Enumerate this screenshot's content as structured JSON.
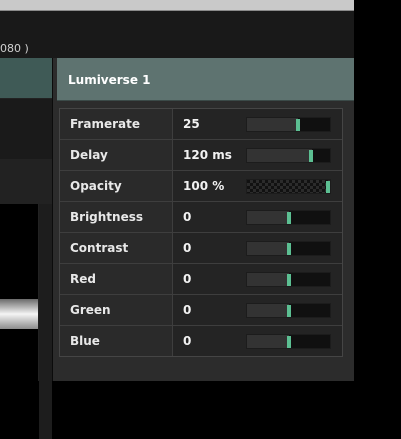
{
  "window": {
    "title_fragment": "080 )"
  },
  "inspector": {
    "title": "Lumiverse 1",
    "rows": [
      {
        "label": "Framerate",
        "value": "25",
        "slider_level": 0.62,
        "checker": false
      },
      {
        "label": "Delay",
        "value": "120 ms",
        "slider_level": 0.78,
        "checker": false
      },
      {
        "label": "Opacity",
        "value": "100 %",
        "slider_level": 1.0,
        "checker": true
      },
      {
        "label": "Brightness",
        "value": "0",
        "slider_level": 0.5,
        "checker": false
      },
      {
        "label": "Contrast",
        "value": "0",
        "slider_level": 0.5,
        "checker": false
      },
      {
        "label": "Red",
        "value": "0",
        "slider_level": 0.5,
        "checker": false
      },
      {
        "label": "Green",
        "value": "0",
        "slider_level": 0.5,
        "checker": false
      },
      {
        "label": "Blue",
        "value": "0",
        "slider_level": 0.5,
        "checker": false
      }
    ]
  },
  "colors": {
    "accent": "#5cbf92",
    "header": "#5e7370"
  }
}
